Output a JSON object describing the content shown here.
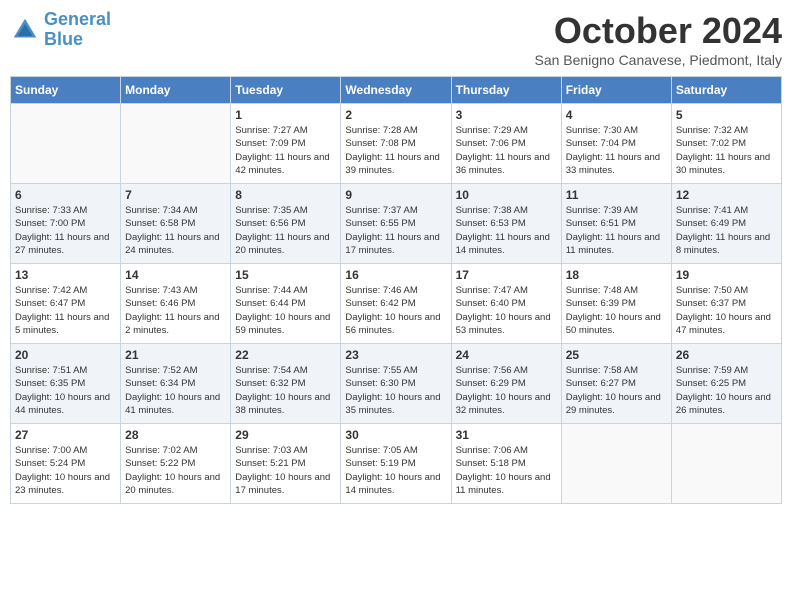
{
  "logo": {
    "line1": "General",
    "line2": "Blue"
  },
  "title": "October 2024",
  "subtitle": "San Benigno Canavese, Piedmont, Italy",
  "days_of_week": [
    "Sunday",
    "Monday",
    "Tuesday",
    "Wednesday",
    "Thursday",
    "Friday",
    "Saturday"
  ],
  "weeks": [
    [
      {
        "num": "",
        "info": ""
      },
      {
        "num": "",
        "info": ""
      },
      {
        "num": "1",
        "info": "Sunrise: 7:27 AM\nSunset: 7:09 PM\nDaylight: 11 hours and 42 minutes."
      },
      {
        "num": "2",
        "info": "Sunrise: 7:28 AM\nSunset: 7:08 PM\nDaylight: 11 hours and 39 minutes."
      },
      {
        "num": "3",
        "info": "Sunrise: 7:29 AM\nSunset: 7:06 PM\nDaylight: 11 hours and 36 minutes."
      },
      {
        "num": "4",
        "info": "Sunrise: 7:30 AM\nSunset: 7:04 PM\nDaylight: 11 hours and 33 minutes."
      },
      {
        "num": "5",
        "info": "Sunrise: 7:32 AM\nSunset: 7:02 PM\nDaylight: 11 hours and 30 minutes."
      }
    ],
    [
      {
        "num": "6",
        "info": "Sunrise: 7:33 AM\nSunset: 7:00 PM\nDaylight: 11 hours and 27 minutes."
      },
      {
        "num": "7",
        "info": "Sunrise: 7:34 AM\nSunset: 6:58 PM\nDaylight: 11 hours and 24 minutes."
      },
      {
        "num": "8",
        "info": "Sunrise: 7:35 AM\nSunset: 6:56 PM\nDaylight: 11 hours and 20 minutes."
      },
      {
        "num": "9",
        "info": "Sunrise: 7:37 AM\nSunset: 6:55 PM\nDaylight: 11 hours and 17 minutes."
      },
      {
        "num": "10",
        "info": "Sunrise: 7:38 AM\nSunset: 6:53 PM\nDaylight: 11 hours and 14 minutes."
      },
      {
        "num": "11",
        "info": "Sunrise: 7:39 AM\nSunset: 6:51 PM\nDaylight: 11 hours and 11 minutes."
      },
      {
        "num": "12",
        "info": "Sunrise: 7:41 AM\nSunset: 6:49 PM\nDaylight: 11 hours and 8 minutes."
      }
    ],
    [
      {
        "num": "13",
        "info": "Sunrise: 7:42 AM\nSunset: 6:47 PM\nDaylight: 11 hours and 5 minutes."
      },
      {
        "num": "14",
        "info": "Sunrise: 7:43 AM\nSunset: 6:46 PM\nDaylight: 11 hours and 2 minutes."
      },
      {
        "num": "15",
        "info": "Sunrise: 7:44 AM\nSunset: 6:44 PM\nDaylight: 10 hours and 59 minutes."
      },
      {
        "num": "16",
        "info": "Sunrise: 7:46 AM\nSunset: 6:42 PM\nDaylight: 10 hours and 56 minutes."
      },
      {
        "num": "17",
        "info": "Sunrise: 7:47 AM\nSunset: 6:40 PM\nDaylight: 10 hours and 53 minutes."
      },
      {
        "num": "18",
        "info": "Sunrise: 7:48 AM\nSunset: 6:39 PM\nDaylight: 10 hours and 50 minutes."
      },
      {
        "num": "19",
        "info": "Sunrise: 7:50 AM\nSunset: 6:37 PM\nDaylight: 10 hours and 47 minutes."
      }
    ],
    [
      {
        "num": "20",
        "info": "Sunrise: 7:51 AM\nSunset: 6:35 PM\nDaylight: 10 hours and 44 minutes."
      },
      {
        "num": "21",
        "info": "Sunrise: 7:52 AM\nSunset: 6:34 PM\nDaylight: 10 hours and 41 minutes."
      },
      {
        "num": "22",
        "info": "Sunrise: 7:54 AM\nSunset: 6:32 PM\nDaylight: 10 hours and 38 minutes."
      },
      {
        "num": "23",
        "info": "Sunrise: 7:55 AM\nSunset: 6:30 PM\nDaylight: 10 hours and 35 minutes."
      },
      {
        "num": "24",
        "info": "Sunrise: 7:56 AM\nSunset: 6:29 PM\nDaylight: 10 hours and 32 minutes."
      },
      {
        "num": "25",
        "info": "Sunrise: 7:58 AM\nSunset: 6:27 PM\nDaylight: 10 hours and 29 minutes."
      },
      {
        "num": "26",
        "info": "Sunrise: 7:59 AM\nSunset: 6:25 PM\nDaylight: 10 hours and 26 minutes."
      }
    ],
    [
      {
        "num": "27",
        "info": "Sunrise: 7:00 AM\nSunset: 5:24 PM\nDaylight: 10 hours and 23 minutes."
      },
      {
        "num": "28",
        "info": "Sunrise: 7:02 AM\nSunset: 5:22 PM\nDaylight: 10 hours and 20 minutes."
      },
      {
        "num": "29",
        "info": "Sunrise: 7:03 AM\nSunset: 5:21 PM\nDaylight: 10 hours and 17 minutes."
      },
      {
        "num": "30",
        "info": "Sunrise: 7:05 AM\nSunset: 5:19 PM\nDaylight: 10 hours and 14 minutes."
      },
      {
        "num": "31",
        "info": "Sunrise: 7:06 AM\nSunset: 5:18 PM\nDaylight: 10 hours and 11 minutes."
      },
      {
        "num": "",
        "info": ""
      },
      {
        "num": "",
        "info": ""
      }
    ]
  ]
}
